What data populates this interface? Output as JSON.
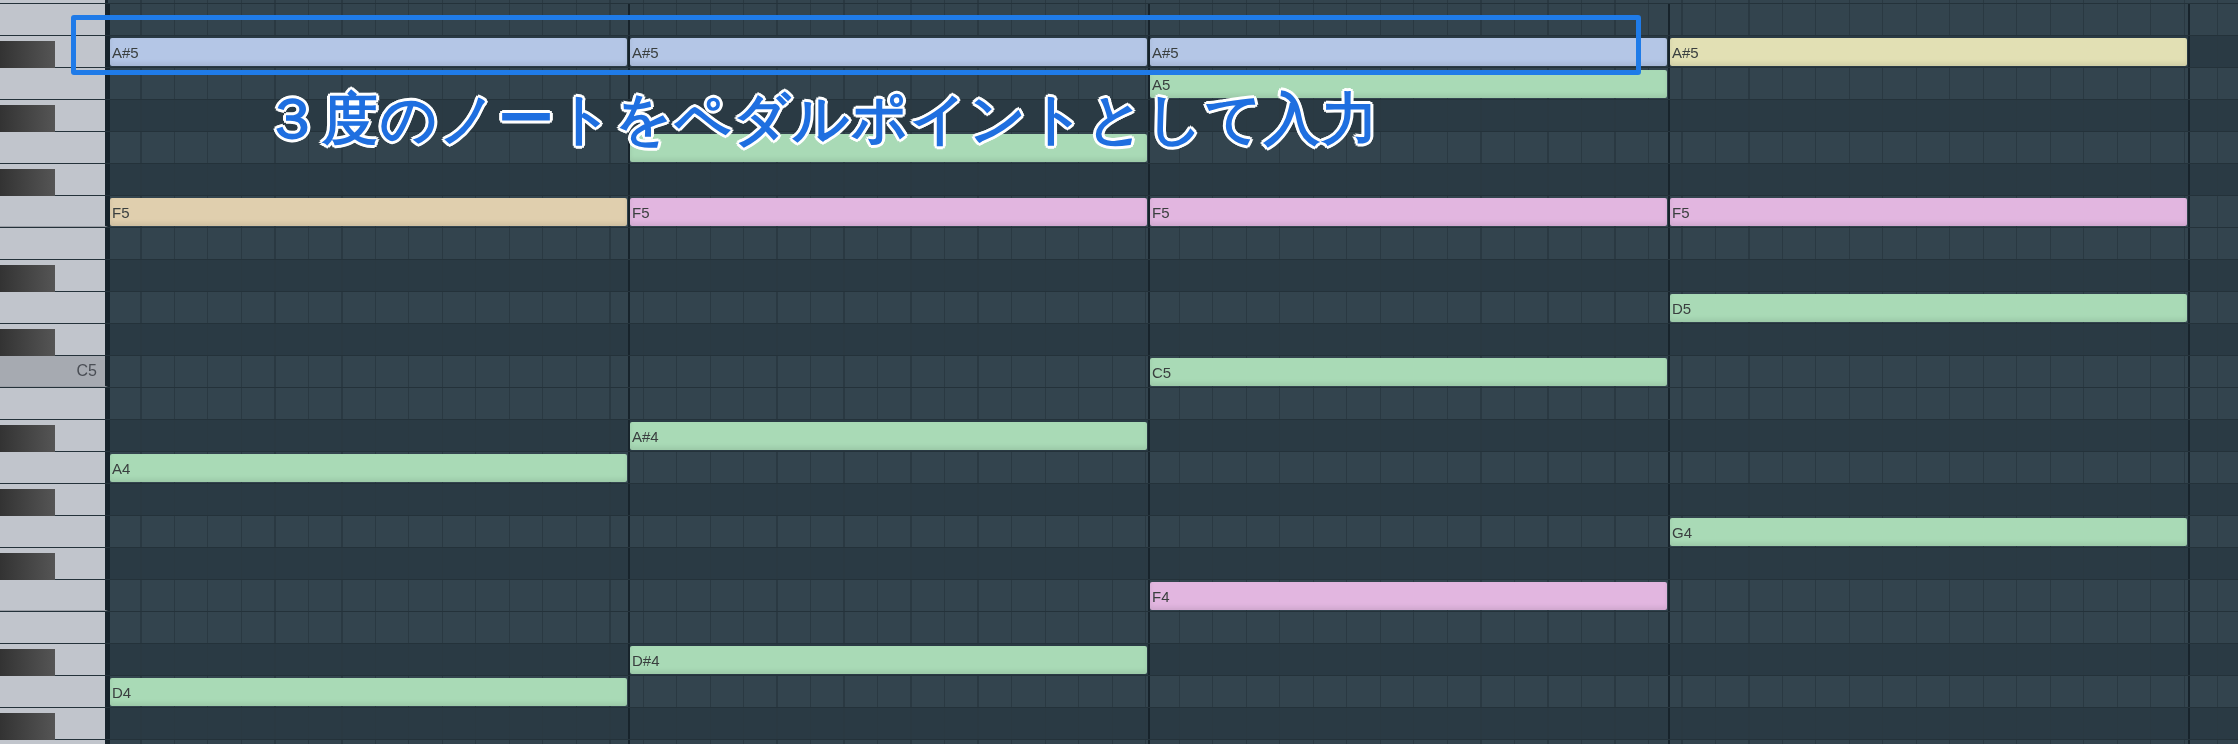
{
  "lanes": [
    {
      "black": false,
      "cells": [
        null,
        null,
        null,
        null
      ]
    },
    {
      "black": true,
      "cells": [
        {
          "label": "A#5",
          "color": "#b4c6e6"
        },
        {
          "label": "A#5",
          "color": "#b4c6e6"
        },
        {
          "label": "A#5",
          "color": "#b4c6e6"
        },
        {
          "label": "A#5",
          "color": "#e2e0b4"
        }
      ]
    },
    {
      "black": false,
      "cells": [
        null,
        null,
        {
          "label": "A5",
          "color": "#a9dab6"
        },
        null
      ]
    },
    {
      "black": true,
      "cells": [
        null,
        null,
        null,
        null
      ]
    },
    {
      "black": false,
      "cells": [
        null,
        {
          "color": "#a9dab6"
        },
        null,
        null
      ]
    },
    {
      "black": true,
      "cells": [
        null,
        null,
        null,
        null
      ]
    },
    {
      "black": false,
      "cells": [
        {
          "label": "F5",
          "color": "#e0cfae"
        },
        {
          "label": "F5",
          "color": "#e2b6e0"
        },
        {
          "label": "F5",
          "color": "#e2b6e0"
        },
        {
          "label": "F5",
          "color": "#e2b6e0"
        }
      ]
    },
    {
      "black": false,
      "cells": [
        null,
        null,
        null,
        null
      ]
    },
    {
      "black": true,
      "cells": [
        null,
        null,
        null,
        null
      ]
    },
    {
      "black": false,
      "cells": [
        null,
        null,
        null,
        {
          "label": "D5",
          "color": "#a9dab6"
        }
      ]
    },
    {
      "black": true,
      "cells": [
        null,
        null,
        null,
        null
      ]
    },
    {
      "black": false,
      "key_label": "C5",
      "cells": [
        null,
        null,
        {
          "label": "C5",
          "color": "#a9dab6"
        },
        null
      ]
    },
    {
      "black": false,
      "cells": [
        null,
        null,
        null,
        null
      ]
    },
    {
      "black": true,
      "cells": [
        null,
        {
          "label": "A#4",
          "color": "#a9dab6"
        },
        null,
        null
      ]
    },
    {
      "black": false,
      "cells": [
        {
          "label": "A4",
          "color": "#a9dab6"
        },
        null,
        null,
        null
      ]
    },
    {
      "black": true,
      "cells": [
        null,
        null,
        null,
        null
      ]
    },
    {
      "black": false,
      "cells": [
        null,
        null,
        null,
        {
          "label": "G4",
          "color": "#a9dab6"
        }
      ]
    },
    {
      "black": true,
      "cells": [
        null,
        null,
        null,
        null
      ]
    },
    {
      "black": false,
      "cells": [
        null,
        null,
        {
          "label": "F4",
          "color": "#e2b6e0"
        },
        null
      ]
    },
    {
      "black": false,
      "cells": [
        null,
        null,
        null,
        null
      ]
    },
    {
      "black": true,
      "cells": [
        null,
        {
          "label": "D#4",
          "color": "#a9dab6"
        },
        null,
        null
      ]
    },
    {
      "black": false,
      "cells": [
        {
          "label": "D4",
          "color": "#a9dab6"
        },
        null,
        null,
        null
      ]
    },
    {
      "black": true,
      "cells": [
        null,
        null,
        null,
        null
      ]
    },
    {
      "black": false,
      "cells": [
        null,
        null,
        null,
        null
      ]
    }
  ],
  "annotation": {
    "caption": "３度のノートをペダルポイントとして入力"
  }
}
